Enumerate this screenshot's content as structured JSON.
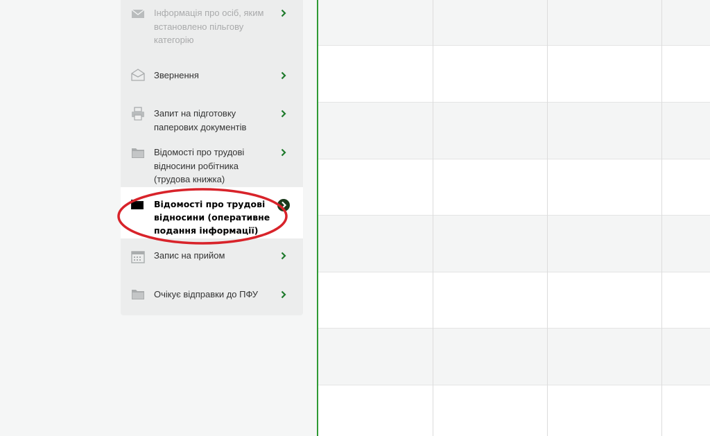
{
  "sidebar": {
    "items": [
      {
        "label": "Інформація про осіб, яким встановлено пільгову категорію",
        "icon": "envelope-icon",
        "state": "disabled"
      },
      {
        "label": "Звернення",
        "icon": "open-envelope-icon",
        "state": "normal"
      },
      {
        "label": "Запит на підготовку паперових документів",
        "icon": "printer-icon",
        "state": "normal"
      },
      {
        "label": "Відомості про трудові відносини робітника (трудова книжка)",
        "icon": "folder-icon",
        "state": "normal"
      },
      {
        "label": "Відомості про трудові відносини (оперативне подання інформації)",
        "icon": "folder-icon",
        "state": "active"
      },
      {
        "label": "Запис на прийом",
        "icon": "calendar-icon",
        "state": "normal"
      },
      {
        "label": "Очікує відправки до ПФУ",
        "icon": "folder-icon",
        "state": "normal"
      }
    ]
  },
  "colors": {
    "accent": "#2f9a34",
    "chevron": "#1e7a2c",
    "annotation": "#d8232a",
    "sidebar_bg": "#eceded",
    "active_bg": "#ffffff"
  }
}
